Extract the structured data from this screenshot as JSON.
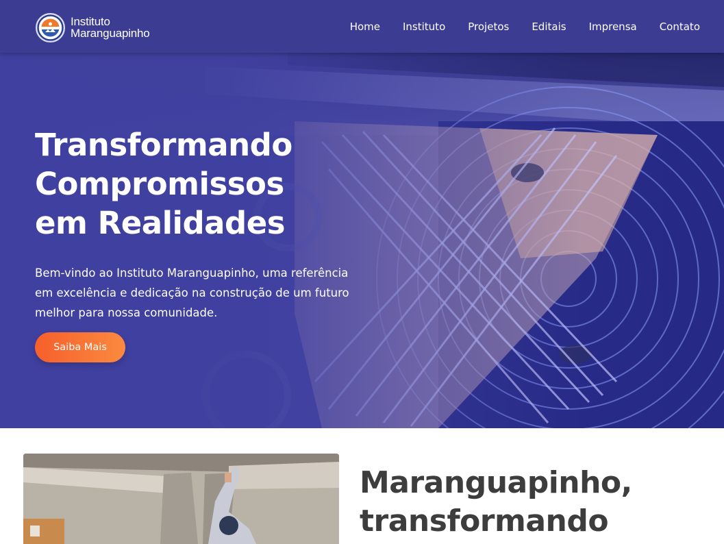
{
  "brand": {
    "name_line1": "Instituto",
    "name_line2": "Maranguapinho",
    "logo_icon": "institute-seal-icon"
  },
  "nav": {
    "items": [
      {
        "label": "Home"
      },
      {
        "label": "Instituto"
      },
      {
        "label": "Projetos"
      },
      {
        "label": "Editais"
      },
      {
        "label": "Imprensa"
      },
      {
        "label": "Contato"
      }
    ]
  },
  "hero": {
    "title_line1": "Transformando",
    "title_line2": "Compromissos",
    "title_line3": "em Realidades",
    "text": "Bem-vindo ao Instituto Maranguapinho, uma referência em excelência e dedicação na construção de um futuro melhor para nossa comunidade.",
    "button_label": "Saiba Mais"
  },
  "about": {
    "title_line1": "Maranguapinho,",
    "title_line2": "transformando"
  },
  "colors": {
    "header_bg": "#3c3d92",
    "hero_bg": "#4243a0",
    "accent_orange": "#f65f2b",
    "heading_dark": "#3d3d3d"
  }
}
